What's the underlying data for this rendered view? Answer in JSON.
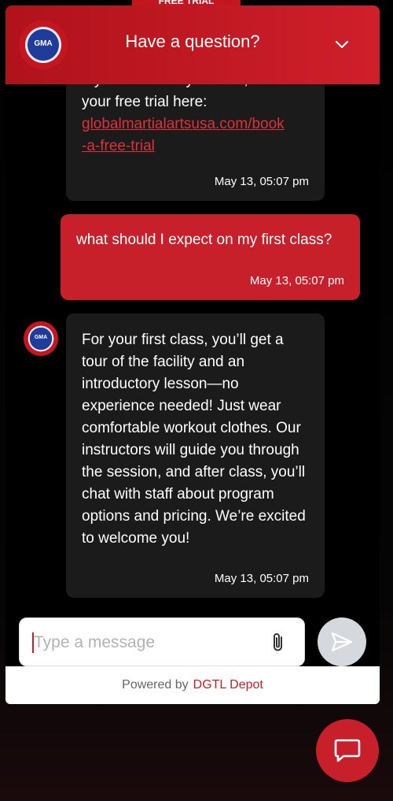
{
  "banner": {
    "label": "FREE TRIAL"
  },
  "header": {
    "title": "Have a question?",
    "logo_text": "GMA"
  },
  "messages": [
    {
      "sender": "bot",
      "line1": "If you'd like to try a class, book",
      "line2": "your free trial here:",
      "link1": "globalmartialartsusa.com/book",
      "link2": "-a-free-trial",
      "time": "May 13, 05:07 pm"
    },
    {
      "sender": "user",
      "text": "what should I expect on my first class?",
      "time": "May 13, 05:07 pm"
    },
    {
      "sender": "bot",
      "text": "For your first class, you’ll get a tour of the facility and an introductory lesson—no experience needed! Just wear comfortable workout clothes. Our instructors will guide you through the session, and after class, you’ll chat with staff about program options and pricing. We’re excited to welcome you!",
      "time": "May 13, 05:07 pm"
    }
  ],
  "composer": {
    "placeholder": "Type a message"
  },
  "footer": {
    "powered_by": "Powered by",
    "brand": "DGTL Depot"
  },
  "colors": {
    "brand_red": "#c8202a",
    "bubble_dark": "#1b1b1b",
    "send_disabled": "#d5d8dc"
  },
  "icons": {
    "chevron": "chevron-down-icon",
    "attach": "paperclip-icon",
    "send": "send-icon",
    "launcher": "chat-bubble-icon"
  }
}
